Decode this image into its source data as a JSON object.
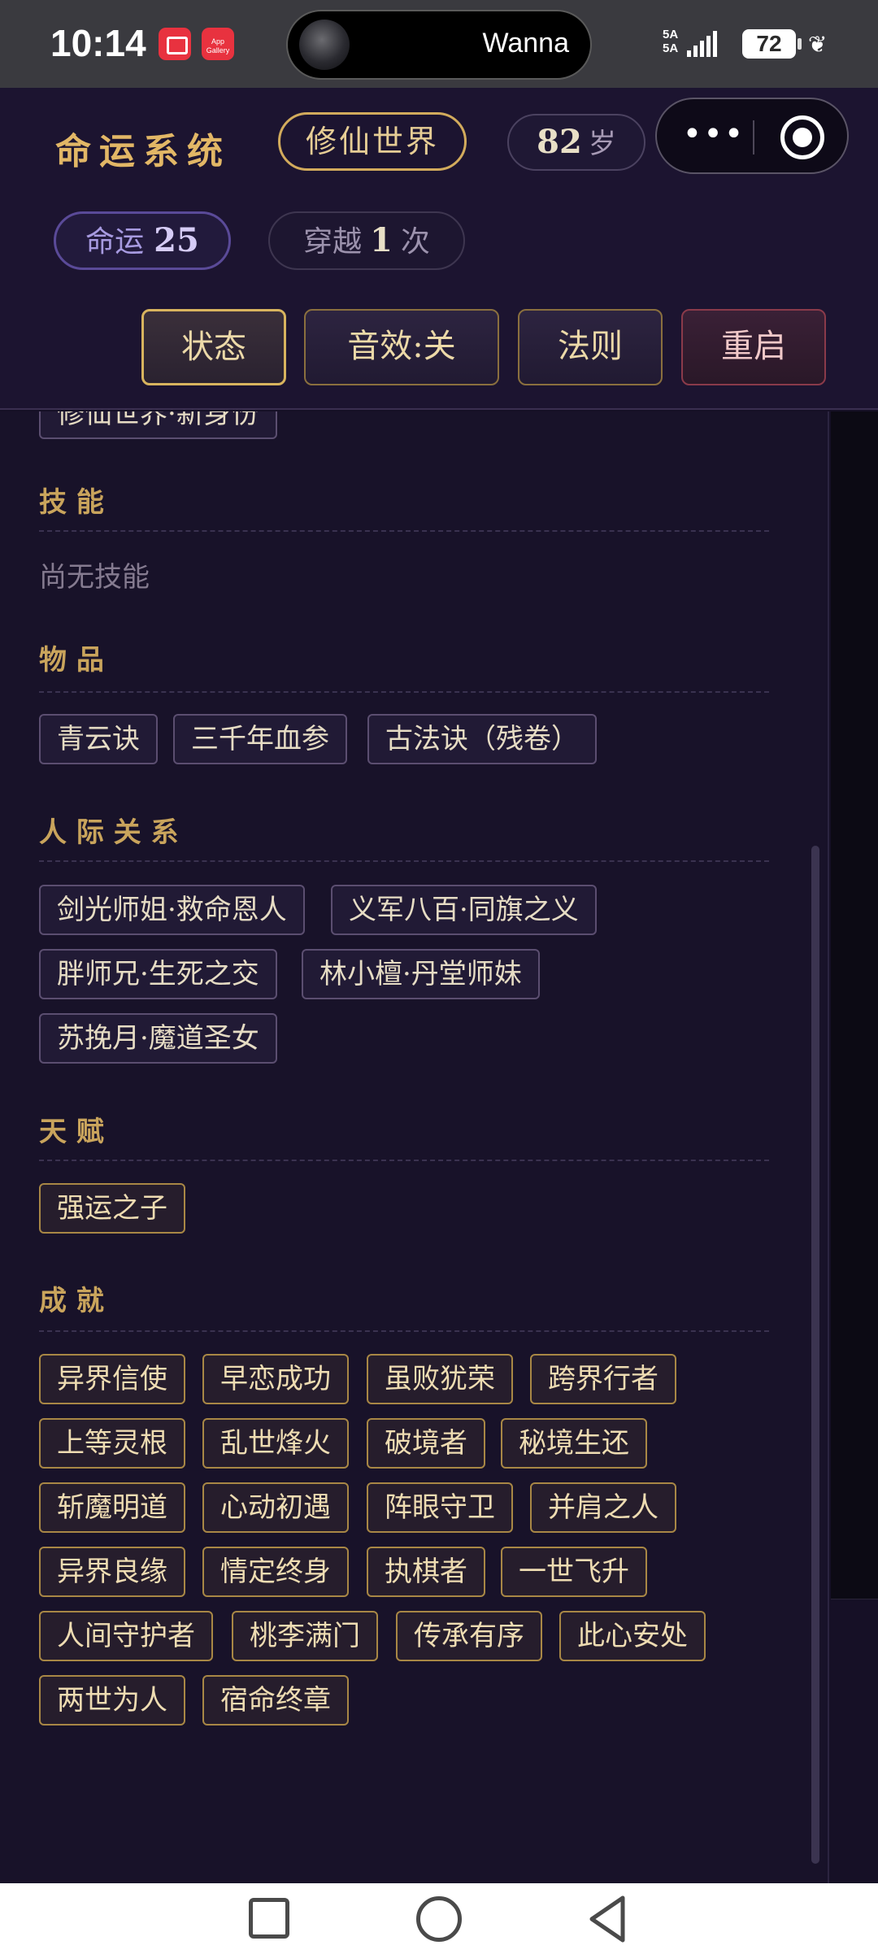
{
  "status_bar": {
    "time": "10:14",
    "app_gallery_label": "App Gallery",
    "media_text": "Wanna",
    "network": "5A",
    "battery": "72"
  },
  "header": {
    "title": "命运系统",
    "world": "修仙世界",
    "age_value": "82",
    "age_unit": "岁",
    "fate_label": "命运",
    "fate_value": "25",
    "crossings_prefix": "穿越",
    "crossings_value": "1",
    "crossings_suffix": "次",
    "buttons": {
      "status": "状态",
      "sound": "音效:关",
      "rules": "法则",
      "restart": "重启"
    }
  },
  "partial_tag": "修仙世界·新身份",
  "sections": {
    "skills": {
      "title": "技 能",
      "empty_text": "尚无技能"
    },
    "items": {
      "title": "物 品",
      "tags": [
        "青云诀",
        "三千年血参",
        "古法诀（残卷）"
      ]
    },
    "relationships": {
      "title": "人 际 关 系",
      "tags": [
        "剑光师姐·救命恩人",
        "义军八百·同旗之义",
        "胖师兄·生死之交",
        "林小檀·丹堂师妹",
        "苏挽月·魔道圣女"
      ]
    },
    "talents": {
      "title": "天 赋",
      "tags": [
        "强运之子"
      ]
    },
    "achievements": {
      "title": "成 就",
      "tags": [
        "异界信使",
        "早恋成功",
        "虽败犹荣",
        "跨界行者",
        "上等灵根",
        "乱世烽火",
        "破境者",
        "秘境生还",
        "斩魔明道",
        "心动初遇",
        "阵眼守卫",
        "并肩之人",
        "异界良缘",
        "情定终身",
        "执棋者",
        "一世飞升",
        "人间守护者",
        "桃李满门",
        "传承有序",
        "此心安处",
        "两世为人",
        "宿命终章"
      ]
    }
  },
  "colors": {
    "background": "#161026",
    "gold": "#c9a45c",
    "purple_accent": "#5a4a98",
    "restart_red": "#8a3a4a"
  }
}
